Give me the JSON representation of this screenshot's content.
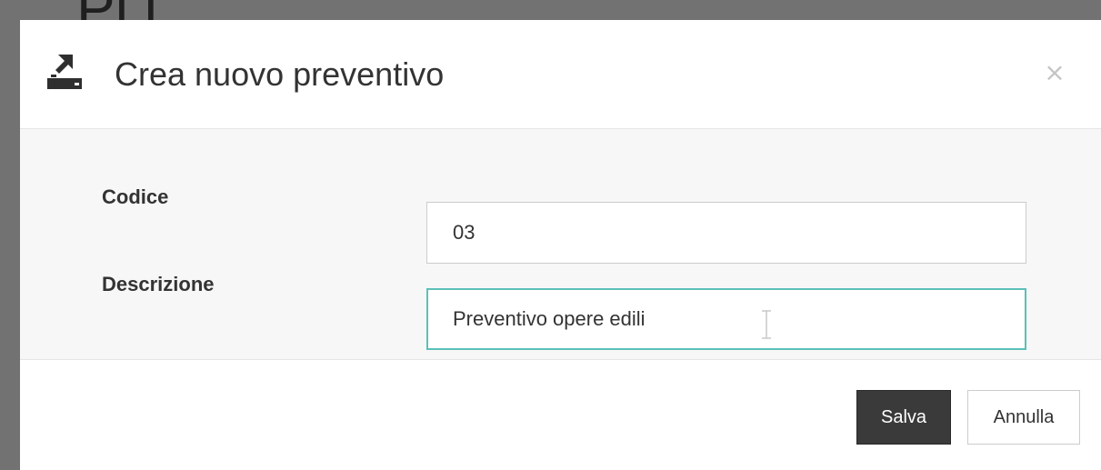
{
  "background": {
    "heading_fragment": "Pl i"
  },
  "modal": {
    "title": "Crea nuovo preventivo",
    "title_icon": "export-icon",
    "close_label": "×",
    "fields": {
      "codice": {
        "label": "Codice",
        "value": "03"
      },
      "descrizione": {
        "label": "Descrizione",
        "value": "Preventivo opere edili"
      }
    },
    "buttons": {
      "save_label": "Salva",
      "cancel_label": "Annulla"
    }
  },
  "colors": {
    "focus_border": "#5bc0b8",
    "primary_button": "#3a3a3a",
    "body_background": "#f7f7f7"
  }
}
